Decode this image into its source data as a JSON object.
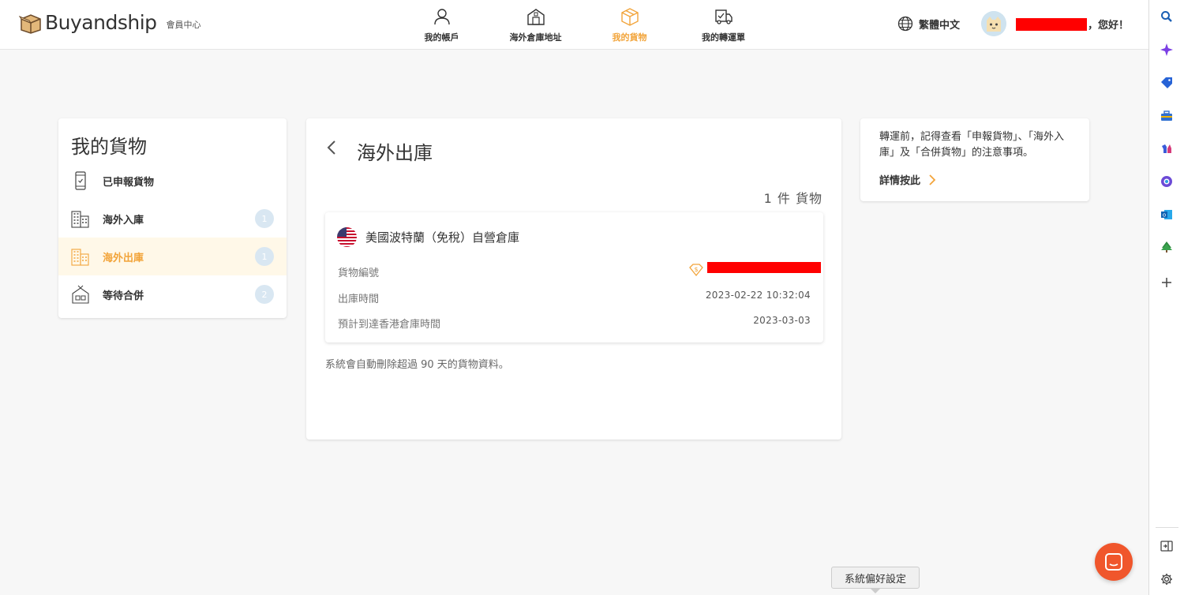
{
  "header": {
    "brand": "Buyandship",
    "subtitle": "會員中心",
    "nav": [
      {
        "label": "我的帳戶",
        "icon": "user-icon"
      },
      {
        "label": "海外倉庫地址",
        "icon": "warehouse-icon"
      },
      {
        "label": "我的貨物",
        "icon": "box-icon",
        "active": true
      },
      {
        "label": "我的轉運單",
        "icon": "truck-icon"
      }
    ],
    "language": "繁體中文",
    "greeting": "，您好！"
  },
  "sidebar": {
    "title": "我的貨物",
    "items": [
      {
        "label": "已申報貨物",
        "icon": "phone-check-icon",
        "count": ""
      },
      {
        "label": "海外入庫",
        "icon": "building-in-icon",
        "count": "1"
      },
      {
        "label": "海外出庫",
        "icon": "building-out-icon",
        "count": "1",
        "active": true
      },
      {
        "label": "等待合併",
        "icon": "house-merge-icon",
        "count": "2"
      }
    ]
  },
  "main": {
    "title": "海外出庫",
    "count_text": "1 件 貨物",
    "item": {
      "warehouse": "美國波特蘭（免稅）自營倉庫",
      "rows": [
        {
          "label": "貨物編號",
          "value": ""
        },
        {
          "label": "出庫時間",
          "value": "2023-02-22 10:32:04"
        },
        {
          "label": "預計到達香港倉庫時間",
          "value": "2023-03-03"
        }
      ]
    },
    "note": "系統會自動刪除超過 90 天的貨物資料。"
  },
  "tip_card": {
    "text": "轉運前，記得查看「申報貨物」、「海外入庫」及「合併貨物」的注意事項。",
    "link": "詳情按此"
  },
  "tooltip": "系統偏好設定",
  "colors": {
    "accent": "#f2a43a",
    "chat": "#f0562c",
    "redaction": "#ff0000"
  }
}
